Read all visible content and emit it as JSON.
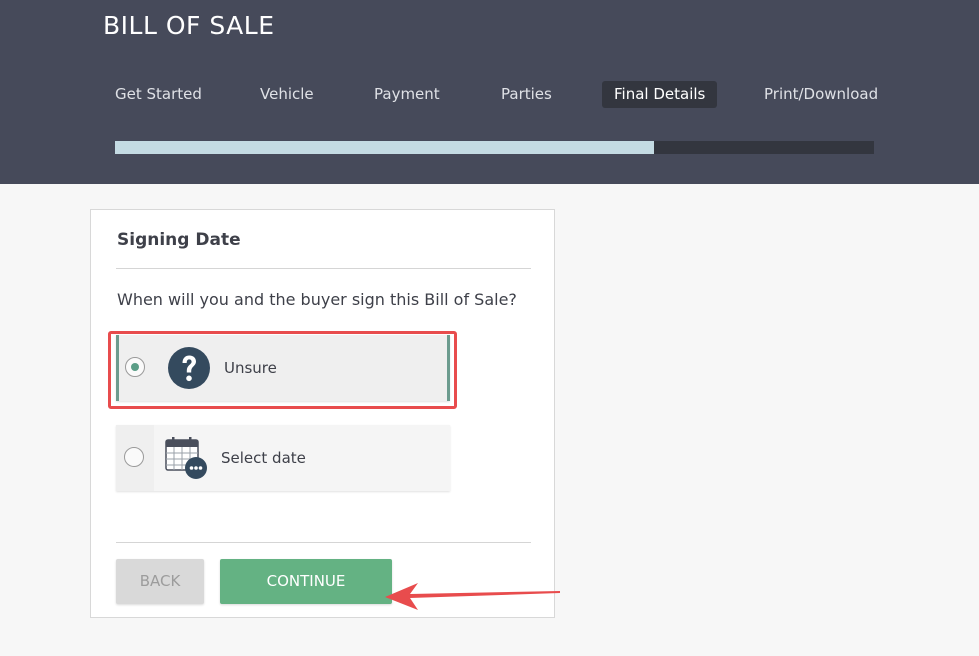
{
  "app": {
    "title": "BILL OF SALE"
  },
  "steps": [
    {
      "label": "Get Started",
      "active": false
    },
    {
      "label": "Vehicle",
      "active": false
    },
    {
      "label": "Payment",
      "active": false
    },
    {
      "label": "Parties",
      "active": false
    },
    {
      "label": "Final Details",
      "active": true
    },
    {
      "label": "Print/Download",
      "active": false
    }
  ],
  "progress": {
    "fraction": 0.71
  },
  "card": {
    "title": "Signing Date",
    "question": "When will you and the buyer sign this Bill of Sale?",
    "options": [
      {
        "label": "Unsure",
        "icon": "question-circle-icon",
        "selected": true
      },
      {
        "label": "Select date",
        "icon": "calendar-more-icon",
        "selected": false
      }
    ]
  },
  "buttons": {
    "back": "BACK",
    "continue": "CONTINUE"
  },
  "colors": {
    "header_bg": "#464a5a",
    "progress_fill": "#c4dbe3",
    "continue_btn": "#64b283",
    "annotation_red": "#e84c4d"
  }
}
